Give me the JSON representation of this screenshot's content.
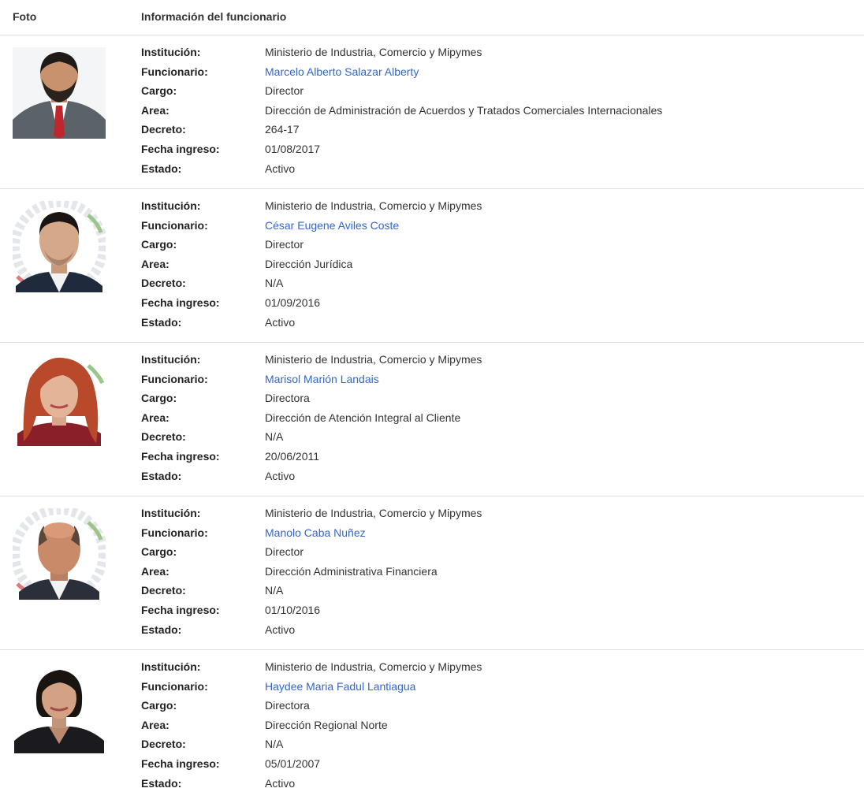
{
  "header": {
    "foto_label": "Foto",
    "info_label": "Información del funcionario"
  },
  "labels": {
    "institucion": "Institución:",
    "funcionario": "Funcionario:",
    "cargo": "Cargo:",
    "area": "Area:",
    "decreto": "Decreto:",
    "fecha_ingreso": "Fecha ingreso:",
    "estado": "Estado:"
  },
  "rows": [
    {
      "institucion": "Ministerio de Industria, Comercio y Mipymes",
      "funcionario": "Marcelo Alberto Salazar Alberty",
      "cargo": "Director",
      "area": "Dirección de Administración de Acuerdos y Tratados Comerciales Internacionales",
      "decreto": "264-17",
      "fecha_ingreso": "01/08/2017",
      "estado": "Activo"
    },
    {
      "institucion": "Ministerio de Industria, Comercio y Mipymes",
      "funcionario": "César Eugene Aviles Coste",
      "cargo": "Director",
      "area": "Dirección Jurídica",
      "decreto": "N/A",
      "fecha_ingreso": "01/09/2016",
      "estado": "Activo"
    },
    {
      "institucion": "Ministerio de Industria, Comercio y Mipymes",
      "funcionario": "Marisol Marión Landais",
      "cargo": "Directora",
      "area": "Dirección de Atención Integral al Cliente",
      "decreto": "N/A",
      "fecha_ingreso": "20/06/2011",
      "estado": "Activo"
    },
    {
      "institucion": "Ministerio de Industria, Comercio y Mipymes",
      "funcionario": "Manolo Caba Nuñez",
      "cargo": "Director",
      "area": "Dirección Administrativa Financiera",
      "decreto": "N/A",
      "fecha_ingreso": "01/10/2016",
      "estado": "Activo"
    },
    {
      "institucion": "Ministerio de Industria, Comercio y Mipymes",
      "funcionario": "Haydee Maria Fadul Lantiagua",
      "cargo": "Directora",
      "area": "Dirección Regional Norte",
      "decreto": "N/A",
      "fecha_ingreso": "05/01/2007",
      "estado": "Activo"
    }
  ],
  "colors": {
    "link": "#3366cc",
    "border": "#dddddd"
  }
}
